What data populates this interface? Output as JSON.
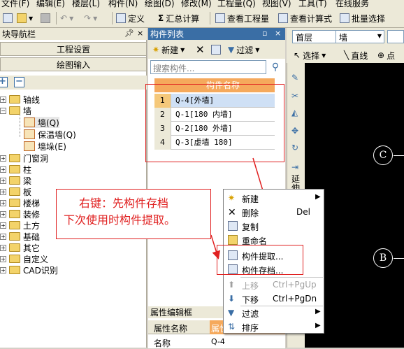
{
  "menubar": [
    "文件(F)",
    "编辑(E)",
    "楼层(L)",
    "构件(N)",
    "绘图(D)",
    "修改(M)",
    "工程量(Q)",
    "视图(V)",
    "工具(T)",
    "在线服务"
  ],
  "toolbar": {
    "define_label": "定义",
    "summary_label": "汇总计算",
    "view_qty_label": "查看工程量",
    "view_formula_label": "查看计算式",
    "batch_select_label": "批量选择"
  },
  "left_panel": {
    "title": "块导航栏",
    "pin": "ⅹ",
    "close": "×",
    "btn_project": "工程设置",
    "btn_draw": "绘图输入",
    "tree": [
      {
        "label": "轴线",
        "level": 0,
        "expanded": false
      },
      {
        "label": "墙",
        "level": 0,
        "expanded": true
      },
      {
        "label": "墙(Q)",
        "level": 1,
        "kind": "component"
      },
      {
        "label": "保温墙(Q)",
        "level": 1,
        "kind": "component"
      },
      {
        "label": "墙垛(E)",
        "level": 1,
        "kind": "component"
      },
      {
        "label": "门窗洞",
        "level": 0,
        "expanded": false
      },
      {
        "label": "柱",
        "level": 0,
        "expanded": false
      },
      {
        "label": "梁",
        "level": 0,
        "expanded": false
      },
      {
        "label": "板",
        "level": 0,
        "expanded": false
      },
      {
        "label": "楼梯",
        "level": 0,
        "expanded": false
      },
      {
        "label": "装修",
        "level": 0,
        "expanded": false
      },
      {
        "label": "土方",
        "level": 0,
        "expanded": false
      },
      {
        "label": "基础",
        "level": 0,
        "expanded": false
      },
      {
        "label": "其它",
        "level": 0,
        "expanded": false
      },
      {
        "label": "自定义",
        "level": 0,
        "expanded": false
      },
      {
        "label": "CAD识别",
        "level": 0,
        "expanded": false
      }
    ]
  },
  "component_list": {
    "title": "构件列表",
    "new_label": "新建",
    "filter_label": "过滤",
    "search_placeholder": "搜索构件...",
    "column_header": "构件名称",
    "rows": [
      {
        "index": "1",
        "name": "Q-4[外墙]",
        "selected": true
      },
      {
        "index": "2",
        "name": "Q-1[180 内墙]",
        "selected": false
      },
      {
        "index": "3",
        "name": "Q-2[180 外墙]",
        "selected": false
      },
      {
        "index": "4",
        "name": "Q-3[虚墙 180]",
        "selected": false
      }
    ]
  },
  "properties": {
    "title": "属性编辑框",
    "col_name": "属性名称",
    "col_value": "属性",
    "row_name": "名称",
    "row_value": "Q-4"
  },
  "right": {
    "floor": "首层",
    "type": "墙",
    "select_label": "选择",
    "line_label": "直线",
    "point_label": "点",
    "extend_label": "延伸",
    "axis_labels": [
      "C",
      "B"
    ]
  },
  "annotation": {
    "line1": "右键：先构件存档",
    "line2": "下次使用时构件提取。"
  },
  "context_menu": [
    {
      "label": "新建",
      "shortcut": "",
      "submenu": true,
      "disabled": false
    },
    {
      "label": "删除",
      "shortcut": "Del",
      "submenu": false,
      "disabled": false
    },
    {
      "label": "复制",
      "shortcut": "",
      "submenu": false,
      "disabled": false
    },
    {
      "label": "重命名",
      "shortcut": "",
      "submenu": false,
      "disabled": false
    },
    {
      "label": "构件提取...",
      "shortcut": "",
      "submenu": false,
      "disabled": false
    },
    {
      "label": "构件存档...",
      "shortcut": "",
      "submenu": false,
      "disabled": false
    },
    {
      "label": "上移",
      "shortcut": "Ctrl+PgUp",
      "submenu": false,
      "disabled": true
    },
    {
      "label": "下移",
      "shortcut": "Ctrl+PgDn",
      "submenu": false,
      "disabled": false
    },
    {
      "label": "过滤",
      "shortcut": "",
      "submenu": true,
      "disabled": false
    },
    {
      "label": "排序",
      "shortcut": "",
      "submenu": true,
      "disabled": false
    }
  ],
  "colors": {
    "accent": "#3a6ea5",
    "grid_header": "#f5a95c",
    "annotation_red": "#e02020",
    "canvas": "#000000"
  }
}
